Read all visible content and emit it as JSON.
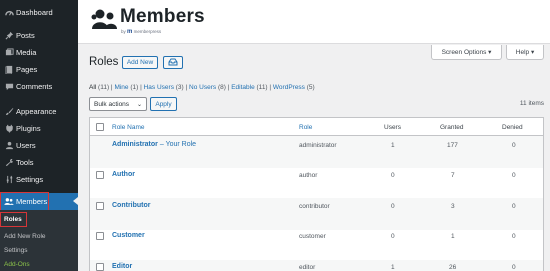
{
  "sidebar": {
    "items": [
      {
        "label": "Dashboard",
        "icon": "dashboard-icon"
      },
      {
        "label": "Posts",
        "icon": "pin-icon"
      },
      {
        "label": "Media",
        "icon": "media-icon"
      },
      {
        "label": "Pages",
        "icon": "pages-icon"
      },
      {
        "label": "Comments",
        "icon": "comment-icon"
      },
      {
        "label": "Appearance",
        "icon": "brush-icon"
      },
      {
        "label": "Plugins",
        "icon": "plugin-icon"
      },
      {
        "label": "Users",
        "icon": "user-icon"
      },
      {
        "label": "Tools",
        "icon": "wrench-icon"
      },
      {
        "label": "Settings",
        "icon": "settings-icon"
      },
      {
        "label": "Members",
        "icon": "members-icon"
      }
    ],
    "submenu": [
      "Roles",
      "Add New Role",
      "Settings",
      "Add-Ons"
    ]
  },
  "header": {
    "logo_text": "Members",
    "logo_by": "by",
    "logo_brand": "memberpress",
    "screen_options": "Screen Options ▾",
    "help": "Help ▾"
  },
  "page": {
    "title": "Roles",
    "add_new": "Add New",
    "filters": {
      "all": "All",
      "all_count": "(11)",
      "mine": "Mine",
      "mine_count": "(1)",
      "has_users": "Has Users",
      "has_users_count": "(3)",
      "no_users": "No Users",
      "no_users_count": "(8)",
      "editable": "Editable",
      "editable_count": "(11)",
      "wordpress": "WordPress",
      "wordpress_count": "(5)"
    },
    "bulk_actions": "Bulk actions",
    "apply": "Apply",
    "items_count": "11 items"
  },
  "table": {
    "columns": [
      "Role Name",
      "Role",
      "Users",
      "Granted",
      "Denied"
    ],
    "rows": [
      {
        "name": "Administrator",
        "suffix": " – Your Role",
        "role": "administrator",
        "users": "1",
        "granted": "177",
        "denied": "0"
      },
      {
        "name": "Author",
        "suffix": "",
        "role": "author",
        "users": "0",
        "granted": "7",
        "denied": "0"
      },
      {
        "name": "Contributor",
        "suffix": "",
        "role": "contributor",
        "users": "0",
        "granted": "3",
        "denied": "0"
      },
      {
        "name": "Customer",
        "suffix": "",
        "role": "customer",
        "users": "0",
        "granted": "1",
        "denied": "0"
      },
      {
        "name": "Editor",
        "suffix": "",
        "role": "editor",
        "users": "1",
        "granted": "26",
        "denied": "0"
      }
    ]
  },
  "colors": {
    "sidebar_bg": "#1d2327",
    "accent": "#2271b1",
    "highlight_box": "#d63638",
    "addons": "#8bc34a"
  }
}
